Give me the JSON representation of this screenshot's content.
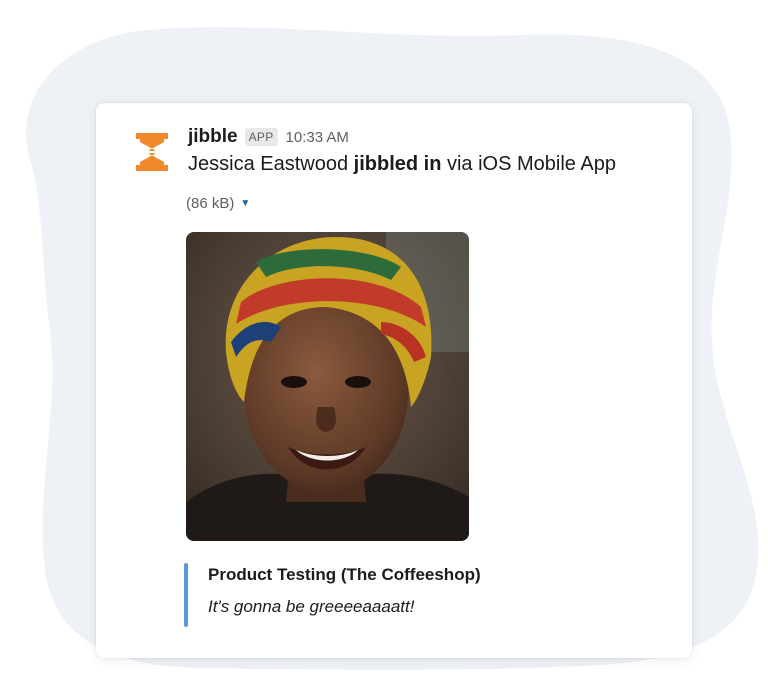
{
  "message": {
    "app_name": "jibble",
    "app_badge": "APP",
    "timestamp": "10:33 AM",
    "user_name": "Jessica Eastwood",
    "action": "jibbled in",
    "suffix": "via iOS Mobile App",
    "file_size": "(86 kB)",
    "photo_icon": "portrait-photo"
  },
  "attachment": {
    "title": "Product Testing (The Coffeeshop)",
    "text": "It's gonna be greeeeaaaatt!"
  },
  "colors": {
    "brand": "#f08a2c",
    "accent_bar": "#5b9ad6",
    "background_blob": "#eef1f5"
  },
  "icons": {
    "logo": "jibble-hourglass-logo",
    "dropdown": "caret-down-icon"
  }
}
